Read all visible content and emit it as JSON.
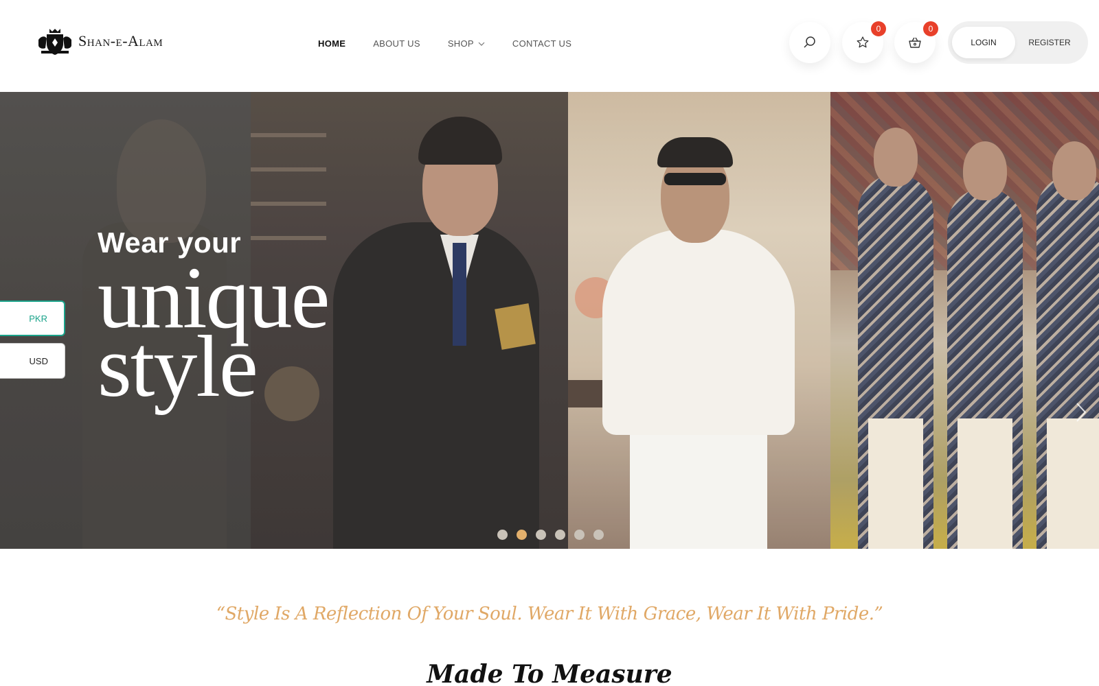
{
  "header": {
    "logo_text": "Shan-e-Alam",
    "nav": [
      {
        "label": "HOME",
        "active": true
      },
      {
        "label": "ABOUT US",
        "active": false
      },
      {
        "label": "SHOP",
        "active": false,
        "has_dropdown": true
      },
      {
        "label": "CONTACT US",
        "active": false
      }
    ],
    "wishlist_count": "0",
    "cart_count": "0",
    "login_label": "LOGIN",
    "register_label": "REGISTER",
    "icons": [
      "search-icon",
      "star-icon",
      "basket-icon"
    ]
  },
  "hero": {
    "line1": "Wear your",
    "line2": "unique",
    "line3": "style",
    "slides_total": 6,
    "active_slide": 2
  },
  "currency": {
    "options": [
      "PKR",
      "USD"
    ],
    "selected": "PKR"
  },
  "quote": "“Style Is A Reflection Of Your Soul. Wear It With Grace, Wear It With Pride.”",
  "section_title": "Made To Measure",
  "colors": {
    "accent_gold": "#e3b06c",
    "badge_red": "#e8402a",
    "currency_teal": "#1aa38a"
  }
}
